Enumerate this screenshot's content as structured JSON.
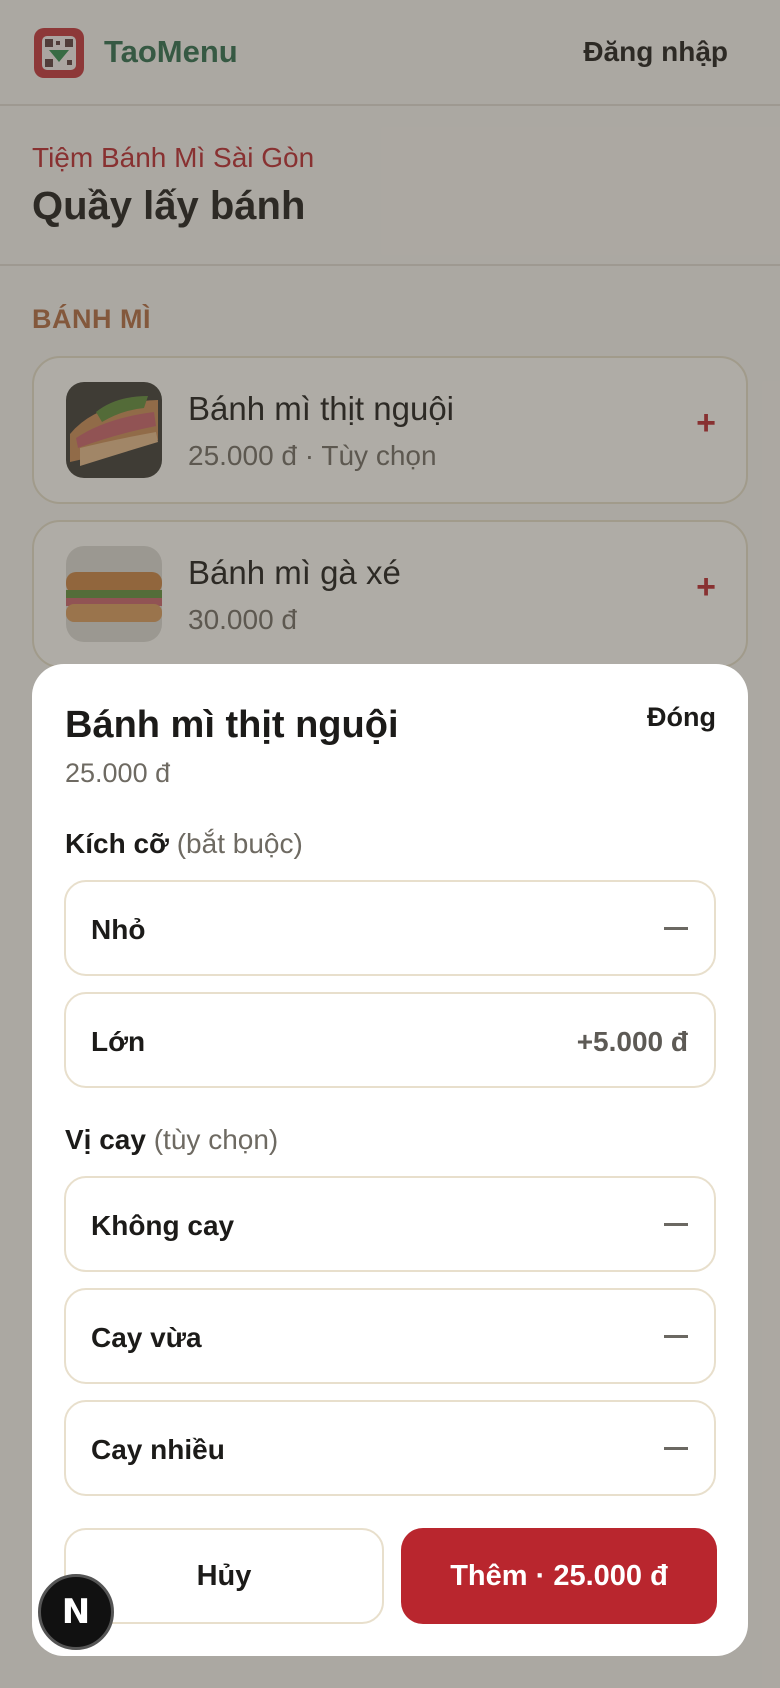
{
  "header": {
    "brand": "TaoMenu",
    "login_label": "Đăng nhập",
    "logo_icon": "qr-menu-logo-icon"
  },
  "store": {
    "name": "Tiệm Bánh Mì Sài Gòn",
    "station": "Quầy lấy bánh"
  },
  "category": {
    "title": "BÁNH MÌ",
    "items": [
      {
        "name": "Bánh mì thịt nguội",
        "meta": "25.000 đ · Tùy chọn",
        "add": "+"
      },
      {
        "name": "Bánh mì gà xé",
        "meta": "30.000 đ",
        "add": "+"
      }
    ]
  },
  "modal": {
    "title": "Bánh mì thịt nguội",
    "price": "25.000 đ",
    "close_label": "Đóng",
    "groups": [
      {
        "name": "Kích cỡ",
        "note": "(bắt buộc)",
        "options": [
          {
            "label": "Nhỏ",
            "price": ""
          },
          {
            "label": "Lớn",
            "price": "+5.000 đ"
          }
        ]
      },
      {
        "name": "Vị cay",
        "note": "(tùy chọn)",
        "options": [
          {
            "label": "Không cay",
            "price": ""
          },
          {
            "label": "Cay vừa",
            "price": ""
          },
          {
            "label": "Cay nhiều",
            "price": ""
          }
        ]
      }
    ],
    "cancel_label": "Hủy",
    "add_label": "Thêm · 25.000 đ"
  },
  "badge": {
    "label": "N"
  },
  "colors": {
    "accent": "#b9262e",
    "brand_green": "#2c6b4c",
    "category_brown": "#b06a40",
    "page_bg": "#f5f3ef"
  }
}
